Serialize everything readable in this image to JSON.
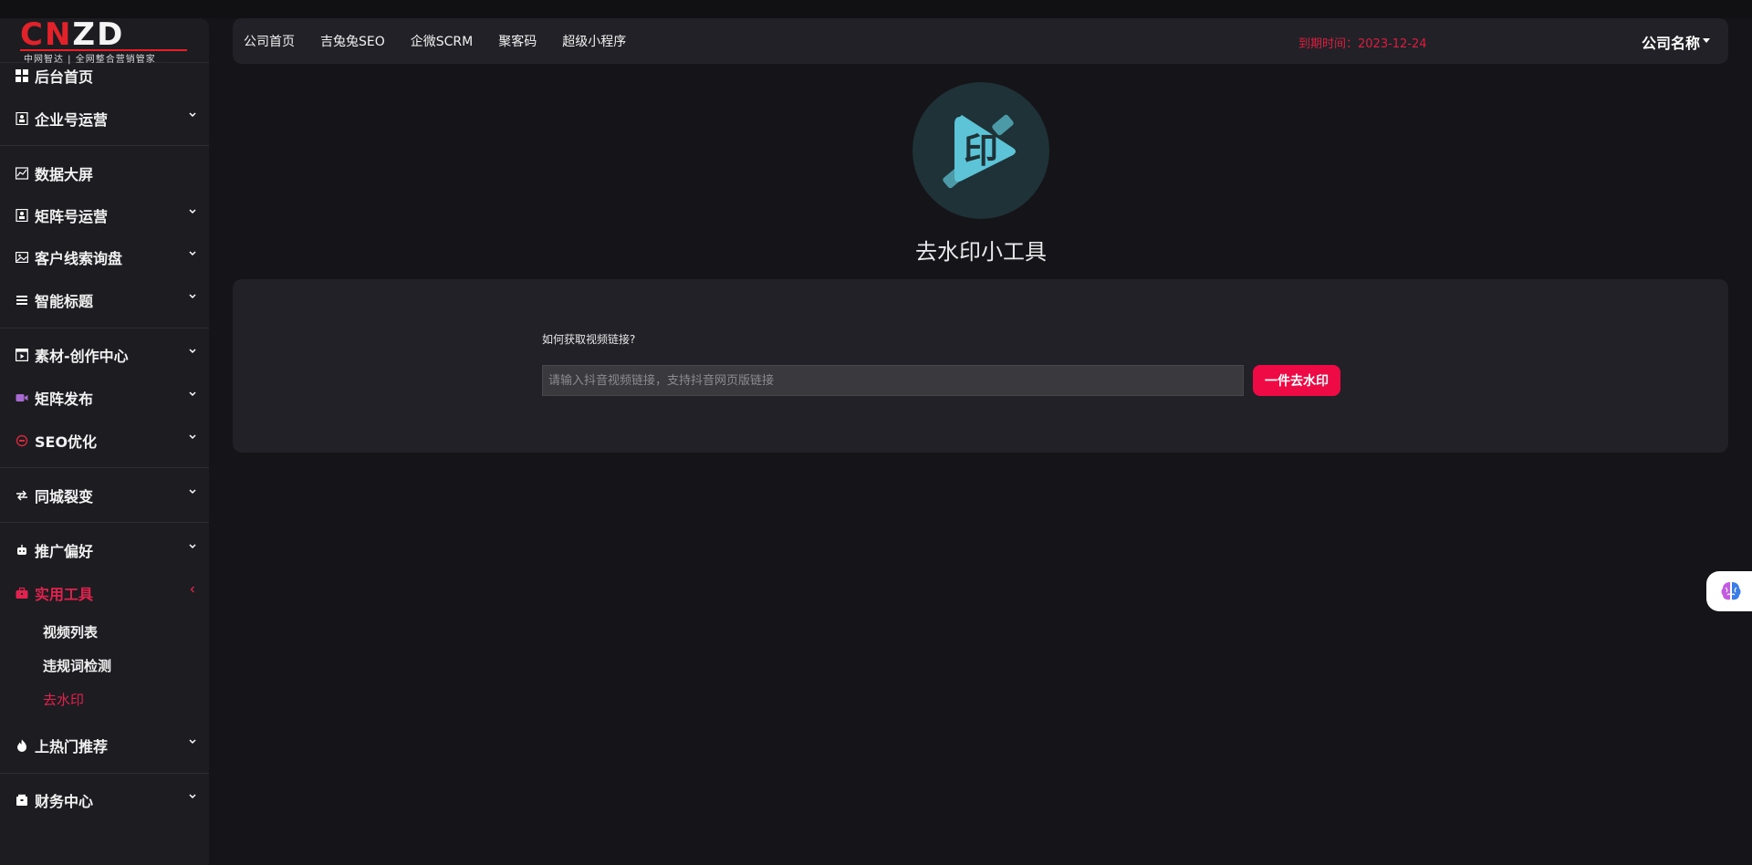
{
  "logo": {
    "text_red": "CN",
    "text_white": "ZD",
    "subtitle": "中网智达 | 全网整合营销管家"
  },
  "sidebar": {
    "items": [
      {
        "label": "后台首页",
        "icon": "dashboard-icon"
      },
      {
        "label": "企业号运营",
        "icon": "id-card-icon"
      },
      {
        "label": "数据大屏",
        "icon": "chart-line-icon"
      },
      {
        "label": "矩阵号运营",
        "icon": "id-card-icon"
      },
      {
        "label": "客户线索询盘",
        "icon": "image-icon"
      },
      {
        "label": "智能标题",
        "icon": "list-icon"
      },
      {
        "label": "素材-创作中心",
        "icon": "video-frame-icon"
      },
      {
        "label": "矩阵发布",
        "icon": "camera-icon"
      },
      {
        "label": "SEO优化",
        "icon": "seo-icon"
      },
      {
        "label": "同城裂变",
        "icon": "exchange-icon"
      },
      {
        "label": "推广偏好",
        "icon": "robot-icon"
      },
      {
        "label": "实用工具",
        "icon": "toolbox-icon"
      },
      {
        "label": "上热门推荐",
        "icon": "fire-icon"
      },
      {
        "label": "财务中心",
        "icon": "wallet-icon"
      }
    ],
    "tools_sub": [
      "视频列表",
      "违规词检测",
      "去水印"
    ]
  },
  "header": {
    "nav": [
      "公司首页",
      "吉兔兔SEO",
      "企微SCRM",
      "聚客码",
      "超级小程序"
    ],
    "expire": "到期时间：2023-12-24",
    "company": "公司名称"
  },
  "hero": {
    "title": "去水印小工具",
    "icon_char": "印"
  },
  "panel": {
    "help": "如何获取视频链接?",
    "input_placeholder": "请输入抖音视频链接，支持抖音网页版链接",
    "input_value": "",
    "button": "一件去水印"
  },
  "colors": {
    "accent": "#ee0b45",
    "active_menu": "#e0234e",
    "expire": "#d91f3f",
    "bg": "#151419",
    "panel": "#222127"
  }
}
